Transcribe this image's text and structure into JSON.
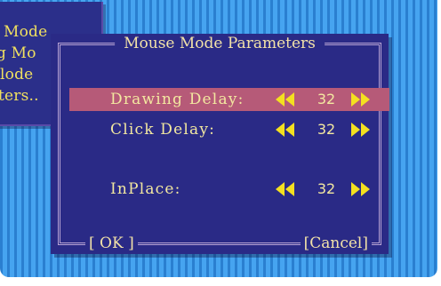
{
  "background_window": {
    "lines": [
      "Mode",
      "g Mo",
      "lode",
      "ters.."
    ]
  },
  "dialog": {
    "title": "Mouse Mode Parameters",
    "rows": [
      {
        "label": "Drawing Delay:",
        "value": "32",
        "selected": true
      },
      {
        "label": "Click Delay:",
        "value": "32",
        "selected": false
      },
      {
        "label": "InPlace:",
        "value": "32",
        "selected": false
      }
    ],
    "ok_label": "[ OK ]",
    "cancel_label": "[Cancel]"
  },
  "icons": {
    "decrease": "double-left-arrow-icon",
    "increase": "double-right-arrow-icon"
  },
  "colors": {
    "dialog_bg": "#2a2a86",
    "text": "#f3e8a0",
    "arrows": "#f4e020",
    "selection": "#b65a78",
    "frame": "#b8a4d4",
    "desktop_stripes": "#46a4f0"
  }
}
